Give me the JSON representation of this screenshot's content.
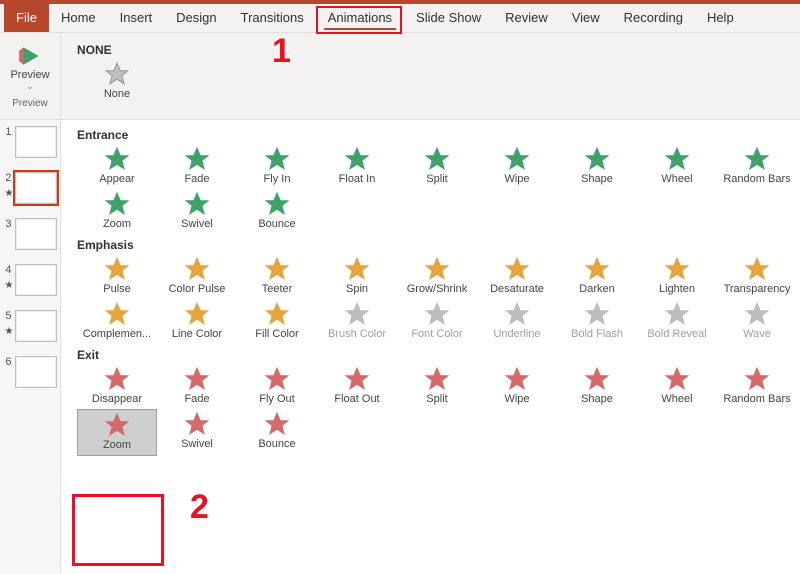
{
  "tabs": {
    "file": "File",
    "home": "Home",
    "insert": "Insert",
    "design": "Design",
    "transitions": "Transitions",
    "animations": "Animations",
    "slideshow": "Slide Show",
    "review": "Review",
    "view": "View",
    "recording": "Recording",
    "help": "Help",
    "active": "animations"
  },
  "ribbon": {
    "preview": {
      "label": "Preview",
      "group": "Preview"
    },
    "none": {
      "title": "NONE",
      "items": [
        "None"
      ]
    }
  },
  "sections": {
    "entrance": {
      "title": "Entrance",
      "items": [
        {
          "l": "Appear"
        },
        {
          "l": "Fade"
        },
        {
          "l": "Fly In"
        },
        {
          "l": "Float In"
        },
        {
          "l": "Split"
        },
        {
          "l": "Wipe"
        },
        {
          "l": "Shape"
        },
        {
          "l": "Wheel"
        },
        {
          "l": "Random Bars"
        },
        {
          "l": "Zoom"
        },
        {
          "l": "Swivel"
        },
        {
          "l": "Bounce"
        }
      ],
      "row2_start": 9
    },
    "emphasis": {
      "title": "Emphasis",
      "items": [
        {
          "l": "Pulse"
        },
        {
          "l": "Color Pulse"
        },
        {
          "l": "Teeter"
        },
        {
          "l": "Spin"
        },
        {
          "l": "Grow/Shrink"
        },
        {
          "l": "Desaturate"
        },
        {
          "l": "Darken"
        },
        {
          "l": "Lighten"
        },
        {
          "l": "Transparency"
        },
        {
          "l": "Complemen..."
        },
        {
          "l": "Line Color"
        },
        {
          "l": "Fill Color"
        },
        {
          "l": "Brush Color",
          "d": true
        },
        {
          "l": "Font Color",
          "d": true
        },
        {
          "l": "Underline",
          "d": true
        },
        {
          "l": "Bold Flash",
          "d": true
        },
        {
          "l": "Bold Reveal",
          "d": true
        },
        {
          "l": "Wave",
          "d": true
        }
      ],
      "row2_start": 9
    },
    "exit": {
      "title": "Exit",
      "items": [
        {
          "l": "Disappear"
        },
        {
          "l": "Fade"
        },
        {
          "l": "Fly Out"
        },
        {
          "l": "Float Out"
        },
        {
          "l": "Split"
        },
        {
          "l": "Wipe"
        },
        {
          "l": "Shape"
        },
        {
          "l": "Wheel"
        },
        {
          "l": "Random Bars"
        },
        {
          "l": "Zoom",
          "sel": true
        },
        {
          "l": "Swivel"
        },
        {
          "l": "Bounce"
        }
      ],
      "row2_start": 9
    }
  },
  "thumbs": [
    {
      "n": "1"
    },
    {
      "n": "2",
      "star": true,
      "sel": true
    },
    {
      "n": "3"
    },
    {
      "n": "4",
      "star": true
    },
    {
      "n": "5",
      "star": true
    },
    {
      "n": "6"
    }
  ],
  "colors": {
    "accent": "#b7472a",
    "entrance": "#3fa26b",
    "emphasis": "#e8a33d",
    "exit": "#d46a6a",
    "disabled": "#bdbdbd",
    "none": "#c0c0c0"
  },
  "annotations": {
    "num1": "1",
    "num2": "2"
  }
}
